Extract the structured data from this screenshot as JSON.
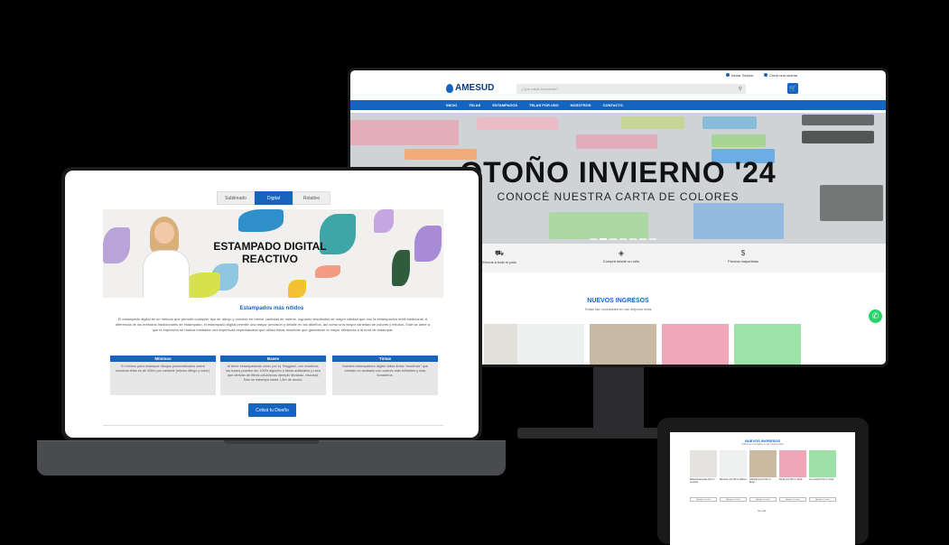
{
  "colors": {
    "primary": "#1565c0",
    "whatsapp": "#25d366"
  },
  "desktop": {
    "topbar": {
      "login": "Iniciar Sesión",
      "register": "Crear una cuenta"
    },
    "logo": "AMESUD",
    "search_placeholder": "¿Qué estás buscando?",
    "nav": [
      "INICIO",
      "TELAS",
      "ESTAMPADOS",
      "TELAS POR USO",
      "NOSOTROS",
      "CONTACTO"
    ],
    "hero_title": "OTOÑO INVIERNO '24",
    "hero_subtitle": "CONOCÉ NUESTRA CARTA DE COLORES",
    "features": [
      "Envíos a todo el país",
      "Comprá desde un rollo",
      "Precios mayoristas"
    ],
    "new_title": "NUEVOS INGRESOS",
    "new_subtitle": "Todas las novedades en las mejores telas"
  },
  "laptop": {
    "tabs": [
      "Sublimado",
      "Digital",
      "Rotativo"
    ],
    "banner_title": "ESTAMPADO DIGITAL REACTIVO",
    "section_title": "Estampados más nítidos",
    "section_text": "El estampado digital es un método que permite cualquier tipo de dibujo y colorido en menor cantidad de metros, logrando resultados de mayor calidad que con la estampación textil tradicional. A diferencia de los métodos tradicionales de estampado, el estampado digital permite una mayor precisión y detalle en los diseños, así como una mayor variedad de colores y efectos. Este se debe a que la impresión se realiza mediante una impresora especializada que utiliza tintas reactivas que garantizan la mayor eficiencia a la hora de estampar.",
    "cards": [
      {
        "title": "Mínimos",
        "text": "El mínimo para estampar dibujos personalizados sobre nuestras telas es de 200m por variante (mismo dibujo y color)."
      },
      {
        "title": "Bases",
        "text": "Al tener estampadoras como por ej. Reggiani, con reactivos, las bases pueden ser 100% algodón o fibras artificiales (o sea que derivan de fibras celulósicas ejemplo fibranas, viscosa). Solo se estampa hasta 1,8m de ancho."
      },
      {
        "title": "Tintas",
        "text": "Nuestra estampadora digital utiliza tintas \"reactivas\" que brindan un acabado con colores más brillantes y más duraderos."
      }
    ],
    "cta": "Cotizá tu Diseño"
  },
  "tablet": {
    "title": "NUEVOS INGRESOS",
    "subtitle": "Todas las novedades en las mejores telas",
    "products": [
      {
        "name": "Batista Estampada 150 cm Lavanda",
        "button": "Agregar al carrito"
      },
      {
        "name": "Bambula Lisa 150 cm Blanco",
        "button": "Agregar al carrito"
      },
      {
        "name": "Gabardina Lisa 150 cm Beige",
        "button": "Agregar al carrito"
      },
      {
        "name": "Modal Liso 150 cm Rosa",
        "button": "Agregar al carrito"
      },
      {
        "name": "Lino Lavado 150 cm Verde",
        "button": "Agregar al carrito"
      }
    ],
    "more": "Ver más"
  }
}
